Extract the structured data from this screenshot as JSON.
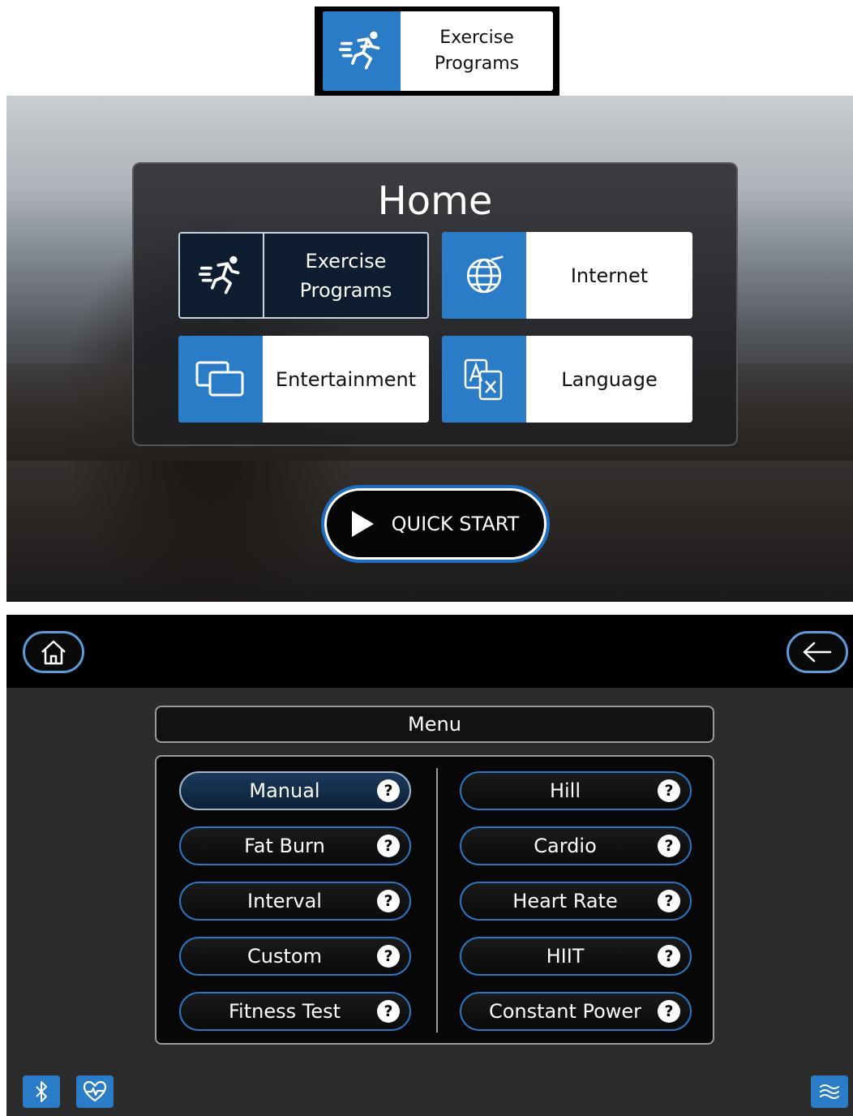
{
  "callout": {
    "icon": "runner-icon",
    "label": "Exercise\nPrograms"
  },
  "home": {
    "title": "Home",
    "tiles": [
      {
        "label": "Exercise\nPrograms",
        "icon": "runner-icon",
        "selected": true
      },
      {
        "label": "Internet",
        "icon": "globe-icon",
        "selected": false
      },
      {
        "label": "Entertainment",
        "icon": "screens-icon",
        "selected": false
      },
      {
        "label": "Language",
        "icon": "translate-icon",
        "selected": false
      }
    ],
    "quick_start": {
      "label": "QUICK START",
      "icon": "play-icon"
    }
  },
  "menu_screen": {
    "home_button_icon": "home-icon",
    "back_button_icon": "back-arrow-icon",
    "menu_title": "Menu",
    "help_glyph": "?",
    "left_programs": [
      {
        "label": "Manual",
        "selected": true
      },
      {
        "label": "Fat Burn",
        "selected": false
      },
      {
        "label": "Interval",
        "selected": false
      },
      {
        "label": "Custom",
        "selected": false
      },
      {
        "label": "Fitness Test",
        "selected": false
      }
    ],
    "right_programs": [
      {
        "label": "Hill",
        "selected": false
      },
      {
        "label": "Cardio",
        "selected": false
      },
      {
        "label": "Heart Rate",
        "selected": false
      },
      {
        "label": "HIIT",
        "selected": false
      },
      {
        "label": "Constant Power",
        "selected": false
      }
    ],
    "bottom_icons": [
      "bluetooth-icon",
      "heart-rate-icon",
      "fan-icon"
    ]
  },
  "colors": {
    "accent_blue": "#2a7cc7",
    "tile_dark": "#0e1e30",
    "pill_border": "#2a76c2"
  }
}
